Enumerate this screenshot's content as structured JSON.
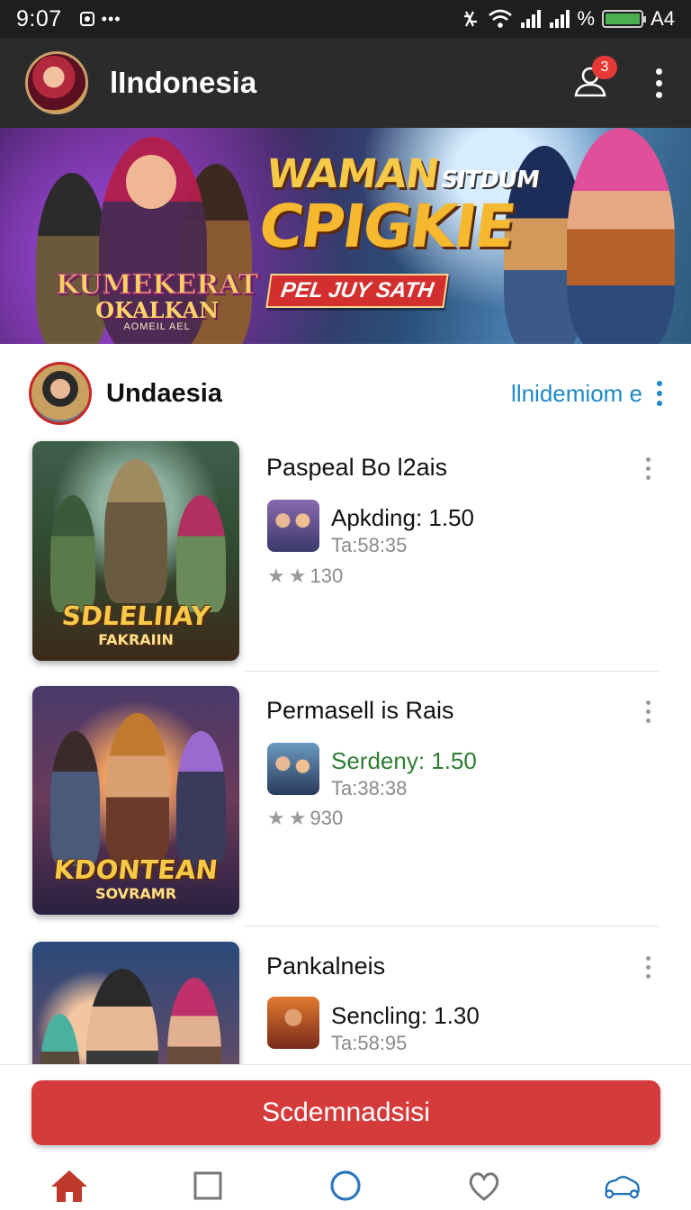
{
  "status_bar": {
    "time": "9:07",
    "signal_text": "%",
    "battery_level": 1.0,
    "battery_label": "A4"
  },
  "app_bar": {
    "title": "lIndonesia",
    "notification_count": "3"
  },
  "banner": {
    "logo_main": "KUMEKERAT",
    "logo_sub": "OKALKAN",
    "logo_tag": "AOMEIL AEL",
    "headline_line1": "WAMAN",
    "headline_line1_small": "SITDUM",
    "headline_line2": "CPIGKIE",
    "cta_label": "PEL JUY SATH"
  },
  "section": {
    "title": "Undaesia",
    "link": "llnidemiom e"
  },
  "items": [
    {
      "title": "Paspeal Bo l2ais",
      "thumb_title": "SDLELIIAY",
      "thumb_subtitle": "FAKRAIIN",
      "version": "Apkding: 1.50",
      "time": "Ta:58:35",
      "rating_count": "130"
    },
    {
      "title": "Permasell is Rais",
      "thumb_title": "KDONTEAN",
      "thumb_subtitle": "SOVRAMR",
      "version": "Serdeny: 1.50",
      "time": "Ta:38:38",
      "rating_count": "930"
    },
    {
      "title": "Pankalneis",
      "version": "Sencling: 1.30",
      "time": "Ta:58:95"
    }
  ],
  "cta": {
    "label": "Scdemnadsisi"
  },
  "colors": {
    "accent_red": "#d63b3b",
    "link_blue": "#1e88c9",
    "version_green": "#2e7d32",
    "nav_active": "#c0392b",
    "nav_blue": "#1e6fb8"
  },
  "nav": [
    "home-icon",
    "square-icon",
    "circle-icon",
    "heart-icon",
    "controller-icon"
  ]
}
